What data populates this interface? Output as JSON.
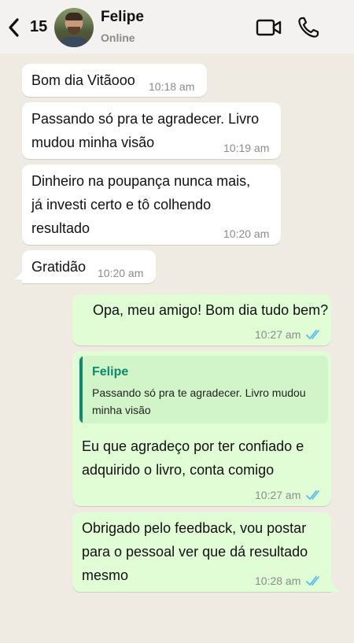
{
  "header": {
    "unread_count": "15",
    "contact_name": "Felipe",
    "status": "Online"
  },
  "messages": [
    {
      "direction": "in",
      "text": "Bom dia Vitãooo",
      "time": "10:18 am"
    },
    {
      "direction": "in",
      "text": "Passando só pra te agradecer. Livro\nmudou minha visão",
      "time": "10:19 am"
    },
    {
      "direction": "in",
      "text": "Dinheiro na poupança nunca mais,\njá investi certo e tô colhendo\nresultado",
      "time": "10:20 am"
    },
    {
      "direction": "in",
      "text": "Gratidão",
      "time": "10:20 am"
    },
    {
      "direction": "out",
      "text": "Opa, meu amigo! Bom dia tudo bem?",
      "time": "10:27 am",
      "read": true
    },
    {
      "direction": "out",
      "quote": {
        "name": "Felipe",
        "text": "Passando só pra te agradecer. Livro mudou minha visão"
      },
      "text": "Eu que agradeço por ter confiado e\nadquirido o livro, conta comigo",
      "time": "10:27 am",
      "read": true
    },
    {
      "direction": "out",
      "text": "Obrigado pelo feedback, vou postar\npara o pessoal ver que dá resultado\nmesmo",
      "time": "10:28 am",
      "read": true
    }
  ],
  "colors": {
    "chat_background": "#efeae2",
    "incoming_bubble": "#ffffff",
    "outgoing_bubble": "#e1fdd6",
    "quote_accent": "#0b8a6c",
    "read_ticks": "#53bdeb"
  },
  "icons": [
    "back-icon",
    "video-call-icon",
    "voice-call-icon",
    "double-check-icon"
  ]
}
